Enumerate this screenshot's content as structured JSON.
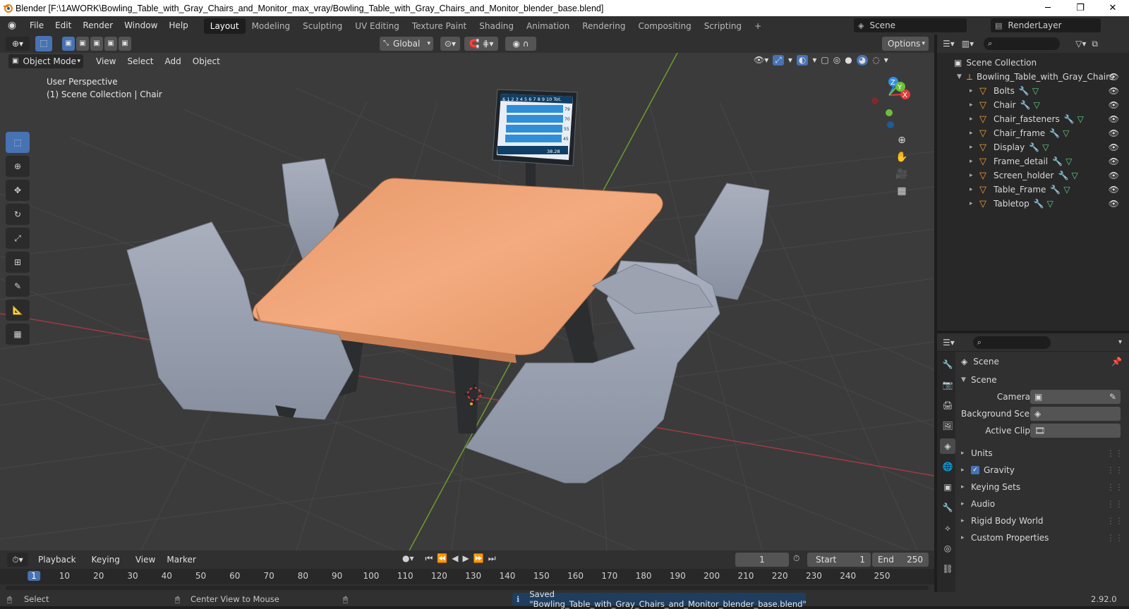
{
  "window": {
    "title": "Blender [F:\\1AWORK\\Bowling_Table_with_Gray_Chairs_and_Monitor_max_vray/Bowling_Table_with_Gray_Chairs_and_Monitor_blender_base.blend]",
    "min": "─",
    "max": "❐",
    "close": "✕"
  },
  "menus": [
    "File",
    "Edit",
    "Render",
    "Window",
    "Help"
  ],
  "workspaces": [
    "Layout",
    "Modeling",
    "Sculpting",
    "UV Editing",
    "Texture Paint",
    "Shading",
    "Animation",
    "Rendering",
    "Compositing",
    "Scripting",
    "+"
  ],
  "scene": {
    "label": "Scene",
    "render_layer": "RenderLayer"
  },
  "toolheader": {
    "transform": "Global",
    "options": "Options"
  },
  "viewport_header": {
    "mode": "Object Mode",
    "menus": [
      "View",
      "Select",
      "Add",
      "Object"
    ]
  },
  "viewport": {
    "perspective": "User Perspective",
    "collection": "(1) Scene Collection | Chair"
  },
  "outliner": {
    "root": "Scene Collection",
    "collection": "Bowling_Table_with_Gray_Chairs",
    "items": [
      "Bolts",
      "Chair",
      "Chair_fasteners",
      "Chair_frame",
      "Display",
      "Frame_detail",
      "Screen_holder",
      "Table_Frame",
      "Tabletop"
    ]
  },
  "properties": {
    "context": "Scene",
    "panel": "Scene",
    "camera_label": "Camera",
    "bg_label": "Background Sce...",
    "clip_label": "Active Clip",
    "sections": [
      "Units",
      "Gravity",
      "Keying Sets",
      "Audio",
      "Rigid Body World",
      "Custom Properties"
    ],
    "gravity_checked": true
  },
  "timeline": {
    "menus": [
      "Playback",
      "Keying",
      "View",
      "Marker"
    ],
    "current": "1",
    "start_label": "Start",
    "start": "1",
    "end_label": "End",
    "end": "250",
    "frames": [
      "1",
      "10",
      "20",
      "30",
      "40",
      "50",
      "60",
      "70",
      "80",
      "90",
      "100",
      "110",
      "120",
      "130",
      "140",
      "150",
      "160",
      "170",
      "180",
      "190",
      "200",
      "210",
      "220",
      "230",
      "240",
      "250"
    ]
  },
  "statusbar": {
    "select": "Select",
    "center": "Center View to Mouse",
    "message": "Saved \"Bowling_Table_with_Gray_Chairs_and_Monitor_blender_base.blend\"",
    "version": "2.92.0"
  },
  "monitor": {
    "header": "6 1 2 3 4 5 6 7 8 9 10 Tot.",
    "scores": [
      "79",
      "70",
      "55",
      "45"
    ],
    "total": "38.28"
  }
}
